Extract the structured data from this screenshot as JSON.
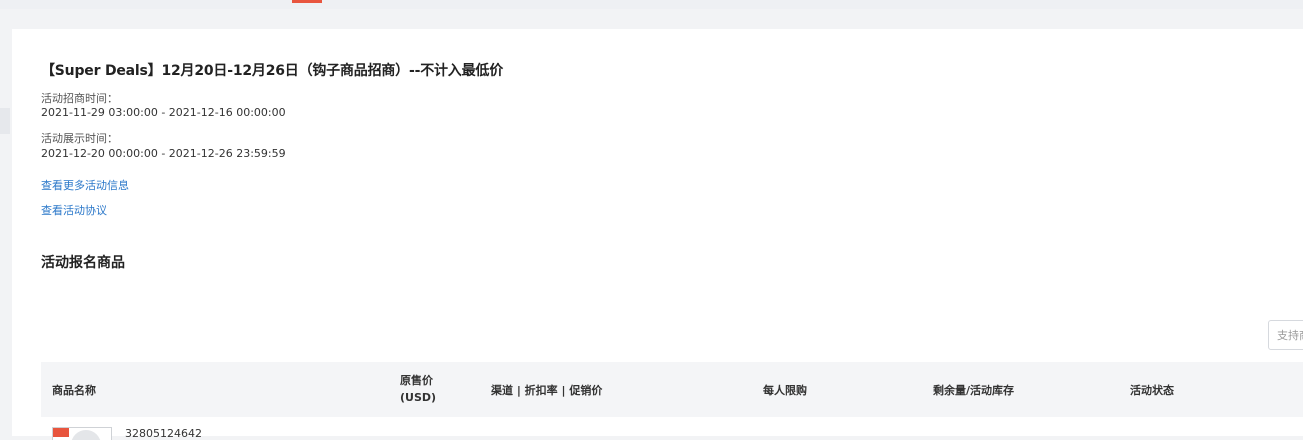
{
  "campaign": {
    "title": "【Super Deals】12月20日-12月26日（钩子商品招商）--不计入最低价",
    "recruit_label": "活动招商时间：",
    "recruit_time": "2021-11-29 03:00:00 - 2021-12-16 00:00:00",
    "display_label": "活动展示时间：",
    "display_time": "2021-12-20 00:00:00 - 2021-12-26 23:59:59",
    "more_info_link": "查看更多活动信息",
    "agreement_link": "查看活动协议"
  },
  "products_section": {
    "title": "活动报名商品",
    "search_placeholder": "支持商品ID搜索",
    "columns": {
      "name": "商品名称",
      "price_line1": "原售价",
      "price_line2": "(USD)",
      "channel": "渠道 | 折扣率 | 促销价",
      "limit": "每人限购",
      "stock": "剩余量/活动库存",
      "status": "活动状态"
    },
    "rows": [
      {
        "product_id": "32805124642"
      }
    ]
  },
  "colors": {
    "link": "#2a77c9",
    "accent": "#e8553e"
  }
}
